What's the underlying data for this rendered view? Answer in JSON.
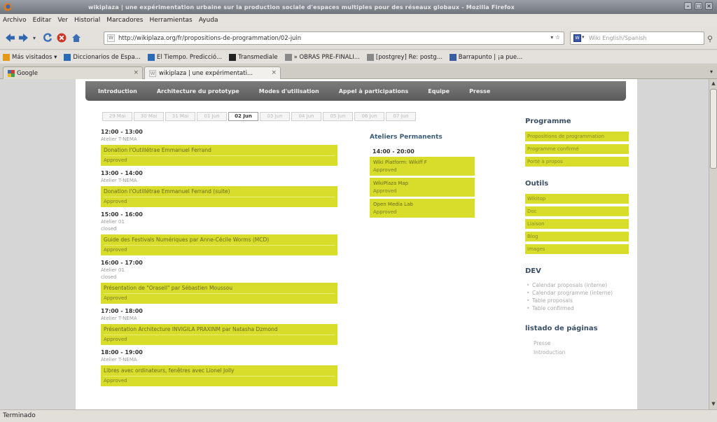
{
  "window": {
    "title": "wikiplaza | une expérimentation urbaine sur la production sociale d'espaces multiples pour des réseaux globaux - Mozilla Firefox"
  },
  "menu": [
    "Archivo",
    "Editar",
    "Ver",
    "Historial",
    "Marcadores",
    "Herramientas",
    "Ayuda"
  ],
  "urlbar": {
    "url": "http://wikiplaza.org/fr/propositions-de-programmation/02-juin"
  },
  "search": {
    "placeholder": "Wiki English/Spanish"
  },
  "bookmarks": [
    {
      "label": "Más visitados ▾",
      "icon": "star-icon",
      "color": "#e39a1a"
    },
    {
      "label": "Diccionarios de Espa...",
      "icon": "book-icon",
      "color": "#2a6bb8"
    },
    {
      "label": "El Tiempo. Predicció...",
      "icon": "weather-icon",
      "color": "#2a6bb8"
    },
    {
      "label": "Transmediale",
      "icon": "tm-icon",
      "color": "#222222"
    },
    {
      "label": "» OBRAS PRE-FINALI...",
      "icon": "doc-icon",
      "color": "#888888"
    },
    {
      "label": "[postgrey] Re: postg...",
      "icon": "doc-icon",
      "color": "#888888"
    },
    {
      "label": "Barrapunto | ¡a pue...",
      "icon": "bp-icon",
      "color": "#3a5fa0"
    }
  ],
  "tabs": [
    {
      "label": "Google",
      "active": false
    },
    {
      "label": "wikiplaza | une expérimentati...",
      "active": true
    }
  ],
  "site_nav": [
    "Introduction",
    "Architecture du prototype",
    "Modes d'utilisation",
    "Appel à participations",
    "Equipe",
    "Presse"
  ],
  "dates": [
    "29 Mai",
    "30 Mai",
    "31 Mai",
    "01 Jun",
    "02 Jun",
    "03 Jun",
    "04 Jun",
    "05 Jun",
    "06 Jun",
    "07 Jun"
  ],
  "active_date": "02 Jun",
  "schedule": [
    {
      "time": "12:00 - 13:00",
      "place": "Atelier T-NEMA",
      "note": "",
      "title": "Donation l'Outillétrae Emmanuel Ferrand",
      "subtitle": "Approved"
    },
    {
      "time": "13:00 - 14:00",
      "place": "Atelier T-NEMA",
      "note": "",
      "title": "Donation l'Outillétrae Emmanuel Ferrand (suite)",
      "subtitle": "Approved"
    },
    {
      "time": "15:00 - 16:00",
      "place": "Atelier 01",
      "note": "closed",
      "title": "Guide des Festivals Numériques par Anne-Cécile Worms (MCD)",
      "subtitle": "Approved"
    },
    {
      "time": "16:00 - 17:00",
      "place": "Atelier 01",
      "note": "closed",
      "title": "Présentation de \"Orasell\" par Sébastien Moussou",
      "subtitle": "Approved"
    },
    {
      "time": "17:00 - 18:00",
      "place": "Atelier T-NEMA",
      "note": "",
      "title": "Présentation Architecture INVIGILA PRAXINM par Natasha Dzmond",
      "subtitle": "Approved"
    },
    {
      "time": "18:00 - 19:00",
      "place": "Atelier T-NEMA",
      "note": "",
      "title": "Libres avec ordinateurs, fenêtres avec Lionel Jolly",
      "subtitle": "Approved"
    }
  ],
  "ateliers": {
    "heading": "Ateliers Permanents",
    "time": "14:00 - 20:00",
    "items": [
      {
        "title": "Wiki Platform: Wikiff F",
        "status": "Approved"
      },
      {
        "title": "WikiPlaza Map",
        "status": "Approved"
      },
      {
        "title": "Open Media Lab",
        "status": "Approved"
      }
    ]
  },
  "sidebar": {
    "programme": {
      "heading": "Programme",
      "links": [
        "Propositions de programmation",
        "Programme confirmé",
        "Porté à propos"
      ]
    },
    "outils": {
      "heading": "Outils",
      "links": [
        "Wikitop",
        "Doc",
        "Liaison",
        "Blog",
        "Images"
      ]
    },
    "dev": {
      "heading": "DEV",
      "items": [
        "Calendar proposals (interne)",
        "Calendar programme (interne)",
        "Table proposals",
        "Table confirmed"
      ]
    },
    "listado": {
      "heading": "listado de páginas",
      "items": [
        "Presse",
        "Introduction"
      ]
    }
  },
  "status": {
    "text": "Terminado"
  }
}
